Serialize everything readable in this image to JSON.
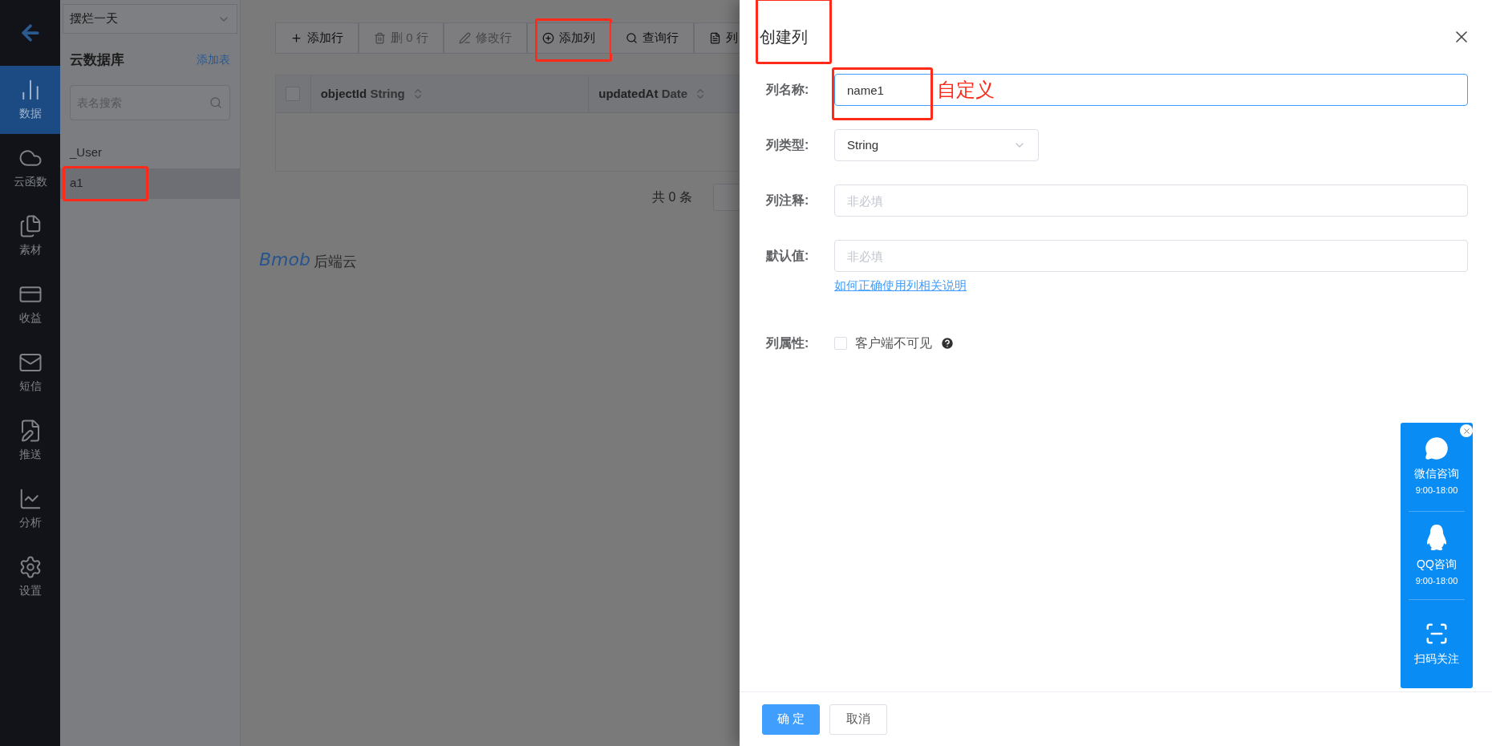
{
  "nav": {
    "items": [
      {
        "label": "数据",
        "selected": true
      },
      {
        "label": "云函数",
        "selected": false
      },
      {
        "label": "素材",
        "selected": false
      },
      {
        "label": "收益",
        "selected": false
      },
      {
        "label": "短信",
        "selected": false
      },
      {
        "label": "推送",
        "selected": false
      },
      {
        "label": "分析",
        "selected": false
      },
      {
        "label": "设置",
        "selected": false
      }
    ]
  },
  "table_panel": {
    "project": "摆烂一天",
    "title": "云数据库",
    "add_link": "添加表",
    "search": {
      "placeholder": "表名搜索"
    },
    "tables": [
      {
        "name": "_User",
        "selected": false,
        "highlighted": false
      },
      {
        "name": "a1",
        "selected": true,
        "highlighted": true
      }
    ]
  },
  "toolbar": [
    {
      "label": "添加行",
      "disabled": false,
      "highlighted": false
    },
    {
      "label": "删 0 行",
      "disabled": true,
      "highlighted": false
    },
    {
      "label": "修改行",
      "disabled": true,
      "highlighted": false
    },
    {
      "label": "添加列",
      "disabled": false,
      "highlighted": true
    },
    {
      "label": "查询行",
      "disabled": false,
      "highlighted": false
    },
    {
      "label": "列",
      "disabled": false,
      "highlighted": false
    }
  ],
  "table": {
    "select_all_checked": false,
    "columns": [
      {
        "name": "objectId",
        "type": "String"
      },
      {
        "name": "updatedAt",
        "type": "Date"
      }
    ]
  },
  "pagination": {
    "total": "共 0 条"
  },
  "brand": {
    "logo": "Bmob",
    "text": "后端云"
  },
  "dialog": {
    "title": "创建列",
    "title_highlighted": true,
    "fields": [
      {
        "label": "列名称:",
        "kind": "text",
        "value": "name1",
        "focused": true,
        "highlighted": true,
        "annotation": "自定义"
      },
      {
        "label": "列类型:",
        "kind": "select",
        "value": "String"
      },
      {
        "label": "列注释:",
        "kind": "text",
        "placeholder": "非必填",
        "focused": false
      },
      {
        "label": "默认值:",
        "kind": "text",
        "placeholder": "非必填",
        "focused": false,
        "help_link": "如何正确使用列相关说明"
      },
      {
        "label": "列属性:",
        "kind": "checkbox",
        "option": "客户端不可见",
        "checked": false
      }
    ],
    "buttons": [
      {
        "label": "确 定",
        "kind": "primary"
      },
      {
        "label": "取消",
        "kind": "default"
      }
    ]
  },
  "contact_widget": {
    "items": [
      {
        "title": "微信咨询",
        "hours": "9:00-18:00"
      },
      {
        "title": "QQ咨询",
        "hours": "9:00-18:00"
      },
      {
        "title": "扫码关注"
      }
    ]
  }
}
